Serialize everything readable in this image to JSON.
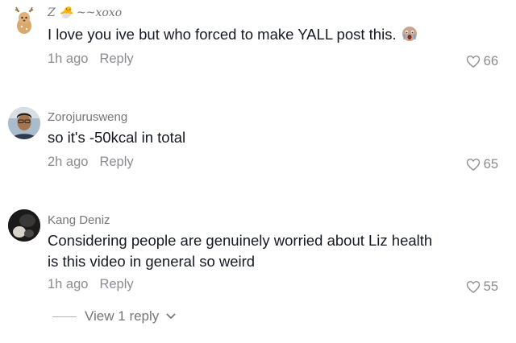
{
  "comments": [
    {
      "username": "Z 🐣 ~~xoxo",
      "text": "I love you ive but who forced to make YALL post this.",
      "time": "1h ago",
      "reply_label": "Reply",
      "likes": "66",
      "avatar_icon": "deer-cartoon-avatar",
      "emoji_icon": "crying-face-emoji"
    },
    {
      "username": "Zorojurusweng",
      "text": "so it's -50kcal in total",
      "time": "2h ago",
      "reply_label": "Reply",
      "likes": "65",
      "avatar_icon": "person-photo-avatar"
    },
    {
      "username": "Kang Deniz",
      "text_line1": "Considering people are genuinely worried about Liz health",
      "text_line2": "is this video in general so weird",
      "time": "1h ago",
      "reply_label": "Reply",
      "likes": "55",
      "avatar_icon": "dark-photo-avatar"
    }
  ],
  "view_replies": {
    "label": "View 1 reply",
    "icon": "chevron-down-icon"
  },
  "colors": {
    "text": "#161823",
    "secondary": "#8a8b91",
    "username": "#75757a"
  }
}
